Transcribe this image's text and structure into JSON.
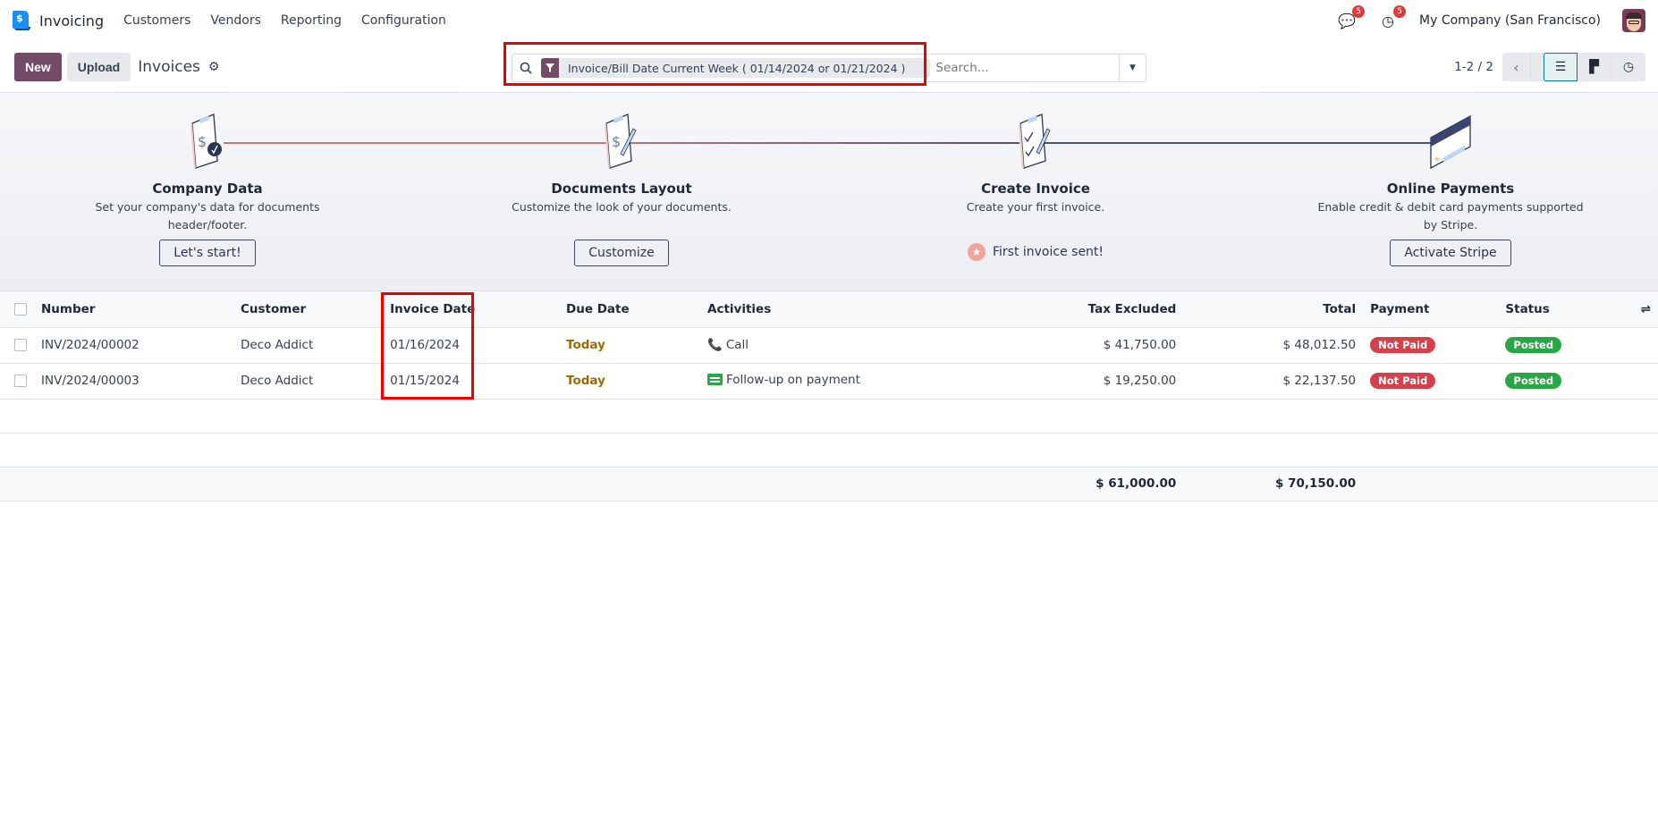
{
  "topbar": {
    "app_name": "Invoicing",
    "menu": [
      "Customers",
      "Vendors",
      "Reporting",
      "Configuration"
    ],
    "messages_badge": "5",
    "activities_badge": "5",
    "company": "My Company (San Francisco)"
  },
  "control": {
    "new_label": "New",
    "upload_label": "Upload",
    "title": "Invoices",
    "search": {
      "facet": "Invoice/Bill Date Current Week ( 01/14/2024 or 01/21/2024 )",
      "placeholder": "Search..."
    },
    "pager": "1-2 / 2"
  },
  "onboarding": [
    {
      "title": "Company Data",
      "desc": "Set your company's data for documents header/footer.",
      "button": "Let's start!"
    },
    {
      "title": "Documents Layout",
      "desc": "Customize the look of your documents.",
      "button": "Customize"
    },
    {
      "title": "Create Invoice",
      "desc": "Create your first invoice.",
      "done_text": "First invoice sent!"
    },
    {
      "title": "Online Payments",
      "desc": "Enable credit & debit card payments supported by Stripe.",
      "button": "Activate Stripe"
    }
  ],
  "table": {
    "headers": [
      "Number",
      "Customer",
      "Invoice Date",
      "Due Date",
      "Activities",
      "Tax Excluded",
      "Total",
      "Payment",
      "Status"
    ],
    "rows": [
      {
        "number": "INV/2024/00002",
        "customer": "Deco Addict",
        "invoice_date": "01/16/2024",
        "due_date": "Today",
        "activity": "Call",
        "activity_icon": "phone-icon",
        "tax_excluded": "$ 41,750.00",
        "total": "$ 48,012.50",
        "payment": "Not Paid",
        "status": "Posted"
      },
      {
        "number": "INV/2024/00003",
        "customer": "Deco Addict",
        "invoice_date": "01/15/2024",
        "due_date": "Today",
        "activity": "Follow-up on payment",
        "activity_icon": "followup-icon",
        "tax_excluded": "$ 19,250.00",
        "total": "$ 22,137.50",
        "payment": "Not Paid",
        "status": "Posted"
      }
    ],
    "totals": {
      "tax_excluded": "$ 61,000.00",
      "total": "$ 70,150.00"
    }
  },
  "colors": {
    "brand": "#714b67",
    "not_paid": "#d6404c",
    "posted": "#28a745",
    "today": "#9a6b02",
    "highlight": "#ef0000"
  }
}
